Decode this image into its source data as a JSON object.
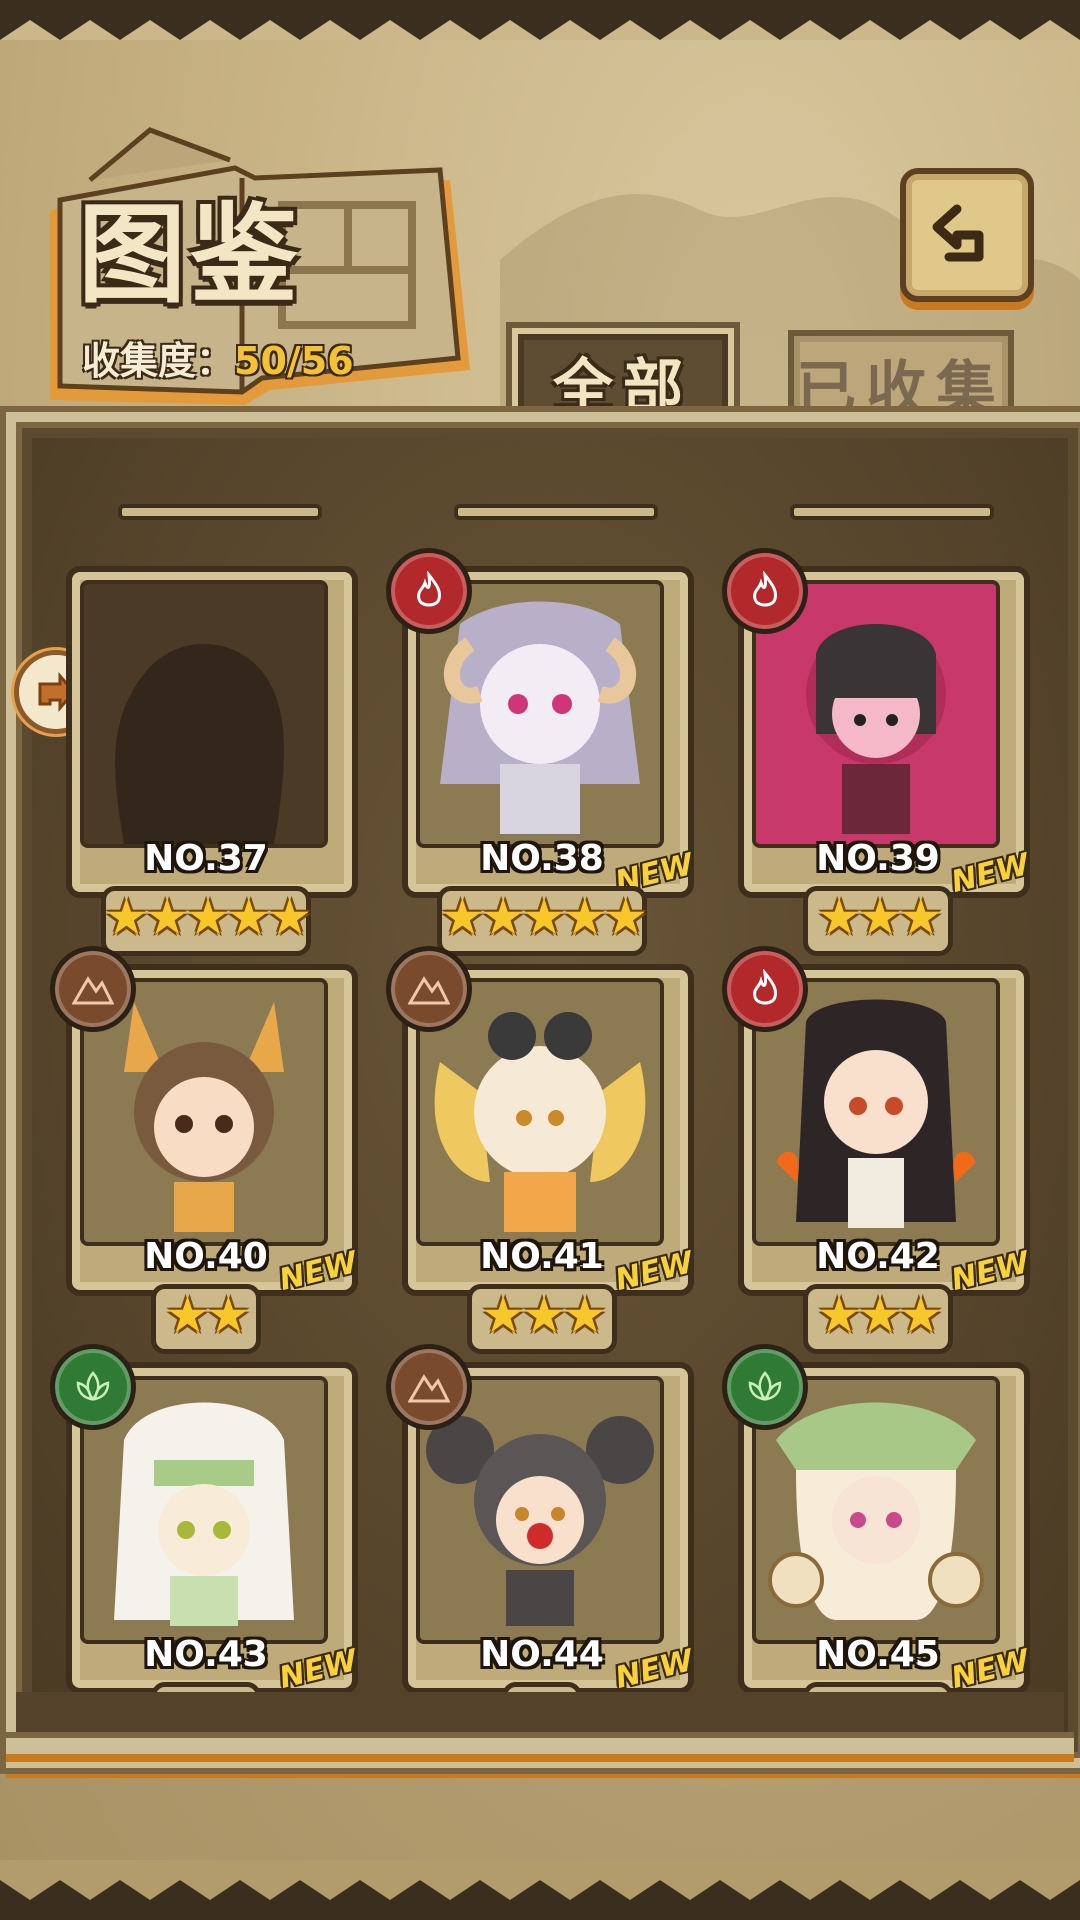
{
  "header": {
    "title": "图鉴",
    "collect_label": "收集度：",
    "collect_value": "50/56"
  },
  "tabs": {
    "all": "全部",
    "collected": "已收集"
  },
  "colors": {
    "fire": "#b3282a",
    "earth": "#7a4a2c",
    "nature": "#2f7a34",
    "star": "#f8c72a",
    "new": "#f7d23a"
  },
  "cards": [
    {
      "no": "NO.37",
      "stars": "★★★★★",
      "new": "",
      "element": "",
      "silhouette": true
    },
    {
      "no": "NO.38",
      "stars": "★★★★★",
      "new": "NEW",
      "element": "fire-icon"
    },
    {
      "no": "NO.39",
      "stars": "★★★",
      "new": "NEW",
      "element": "fire-icon"
    },
    {
      "no": "NO.40",
      "stars": "★★",
      "new": "NEW",
      "element": "mountain-icon"
    },
    {
      "no": "NO.41",
      "stars": "★★★",
      "new": "NEW",
      "element": "mountain-icon"
    },
    {
      "no": "NO.42",
      "stars": "★★★",
      "new": "NEW",
      "element": "fire-icon"
    },
    {
      "no": "NO.43",
      "stars": "★★",
      "new": "NEW",
      "element": "leaf-icon"
    },
    {
      "no": "NO.44",
      "stars": "★",
      "new": "NEW",
      "element": "mountain-icon"
    },
    {
      "no": "NO.45",
      "stars": "★★★",
      "new": "NEW",
      "element": "leaf-icon"
    }
  ]
}
